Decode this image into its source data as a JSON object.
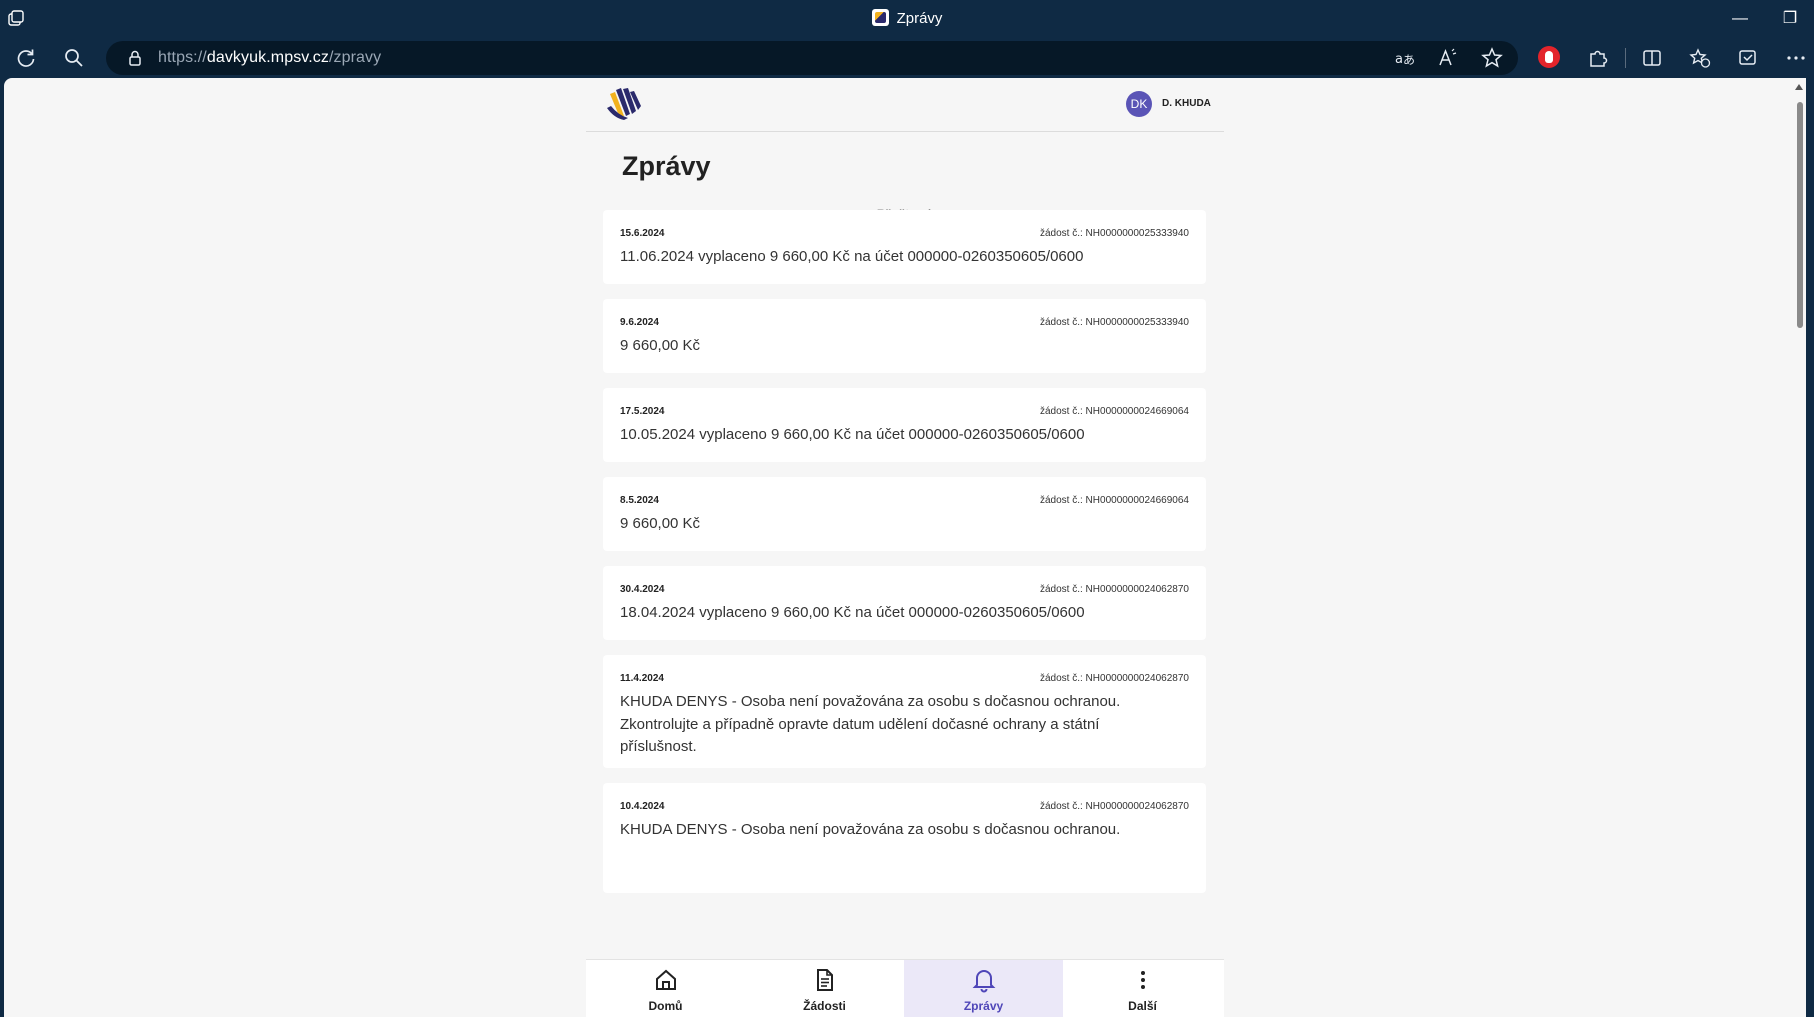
{
  "browser": {
    "tab_title": "Zprávy",
    "url_scheme": "https://",
    "url_host": "davkyuk.mpsv.cz",
    "url_path": "/zpravy",
    "window_buttons": {
      "minimize": "—",
      "restore": "❐"
    }
  },
  "header": {
    "avatar_initials": "DK",
    "user_name": "D. KHUDA"
  },
  "page": {
    "title": "Zprávy",
    "section_label": "Přečtené"
  },
  "messages": [
    {
      "date": "15.6.2024",
      "ref": "žádost č.: NH0000000025333940",
      "text": "11.06.2024 vyplaceno 9 660,00 Kč na účet 000000-0260350605/0600"
    },
    {
      "date": "9.6.2024",
      "ref": "žádost č.: NH0000000025333940",
      "text": "9 660,00 Kč"
    },
    {
      "date": "17.5.2024",
      "ref": "žádost č.: NH0000000024669064",
      "text": "10.05.2024 vyplaceno 9 660,00 Kč na účet 000000-0260350605/0600"
    },
    {
      "date": "8.5.2024",
      "ref": "žádost č.: NH0000000024669064",
      "text": "9 660,00 Kč"
    },
    {
      "date": "30.4.2024",
      "ref": "žádost č.: NH0000000024062870",
      "text": "18.04.2024 vyplaceno 9 660,00 Kč na účet 000000-0260350605/0600"
    },
    {
      "date": "11.4.2024",
      "ref": "žádost č.: NH0000000024062870",
      "text": "KHUDA DENYS - Osoba není považována za osobu s dočasnou ochranou. Zkontrolujte a případně opravte datum udělení dočasné ochrany a státní příslušnost."
    },
    {
      "date": "10.4.2024",
      "ref": "žádost č.: NH0000000024062870",
      "text": "KHUDA DENYS - Osoba není považována za osobu s dočasnou ochranou."
    }
  ],
  "bottom_nav": [
    {
      "label": "Domů",
      "icon": "home-icon"
    },
    {
      "label": "Žádosti",
      "icon": "document-icon"
    },
    {
      "label": "Zprávy",
      "icon": "bell-icon",
      "active": true
    },
    {
      "label": "Další",
      "icon": "more-vertical-icon"
    }
  ],
  "colors": {
    "browser_chrome": "#0f2a44",
    "accent": "#5a54b6",
    "active_nav_bg": "#ebe8f8",
    "page_bg": "#f6f6f6"
  }
}
